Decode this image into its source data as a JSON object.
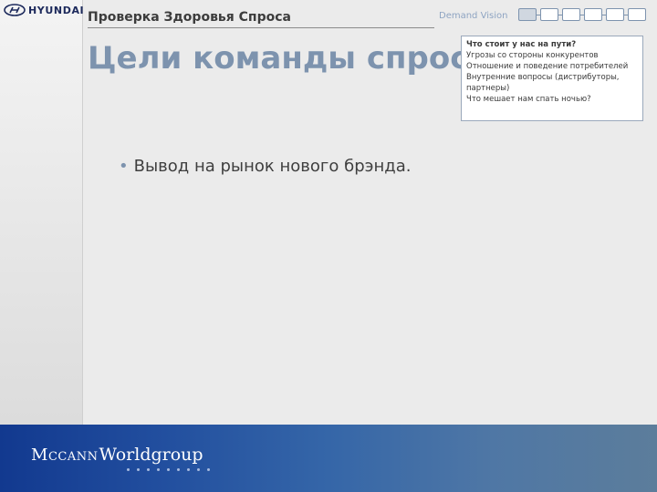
{
  "logo": {
    "text": "HYUNDAI",
    "icon": "hyundai-h-logo"
  },
  "header": {
    "title": "Проверка Здоровья Спроса"
  },
  "page": {
    "title": "Цели команды спроса"
  },
  "nav": {
    "label": "Demand Vision",
    "steps": [
      {
        "active": true
      },
      {
        "active": false
      },
      {
        "active": false
      },
      {
        "active": false
      },
      {
        "active": false
      },
      {
        "active": false
      }
    ]
  },
  "context_box": {
    "heading": "Что стоит у нас на пути?",
    "lines": [
      "Угрозы со стороны конкурентов",
      "Отношение и поведение потребителей",
      "Внутренние вопросы (дистрибуторы, партнеры)",
      "Что мешает нам спать ночью?"
    ]
  },
  "body": {
    "bullets": [
      "Вывод на рынок нового брэнда."
    ]
  },
  "footer": {
    "brand_mc_1": "M",
    "brand_mc_2": "C",
    "brand_mc_3": "CANN",
    "brand_wg": "Worldgroup",
    "colors": {
      "start": "#12398f",
      "end": "#5c7d9b"
    }
  }
}
